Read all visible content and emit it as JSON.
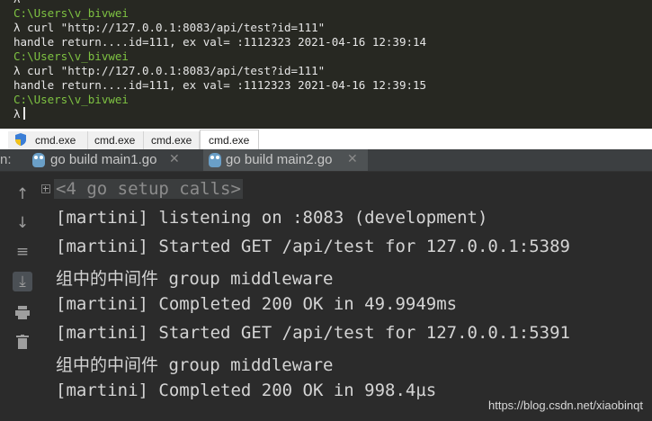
{
  "cmd_window": {
    "lines": [
      {
        "text": "λ",
        "kind": "prompt"
      },
      {
        "text": "C:\\Users\\v_bivwei",
        "kind": "path"
      },
      {
        "text": "λ curl \"http://127.0.0.1:8083/api/test?id=111\"",
        "kind": "text"
      },
      {
        "text": "handle return....id=111, ex val= :1112323 2021-04-16 12:39:14",
        "kind": "text"
      },
      {
        "text": "C:\\Users\\v_bivwei",
        "kind": "path"
      },
      {
        "text": "λ curl \"http://127.0.0.1:8083/api/test?id=111\"",
        "kind": "text"
      },
      {
        "text": "handle return....id=111, ex val= :1112323 2021-04-16 12:39:15",
        "kind": "text"
      },
      {
        "text": "C:\\Users\\v_bivwei",
        "kind": "path"
      },
      {
        "text": "λ",
        "kind": "prompt"
      }
    ],
    "colors": {
      "background": "#272822",
      "path": "#7ec242",
      "text": "#e6e6e6"
    }
  },
  "cmd_tabs": [
    {
      "label": "cmd.exe"
    },
    {
      "label": "cmd.exe"
    },
    {
      "label": "cmd.exe"
    },
    {
      "label": "cmd.exe",
      "active": true
    }
  ],
  "run_bar": {
    "label": "n:",
    "tabs": [
      {
        "label": "go build main1.go",
        "icon": "gopher-icon"
      },
      {
        "label": "go build main2.go",
        "icon": "gopher-icon",
        "active": true
      }
    ]
  },
  "tools": [
    {
      "name": "up-arrow-icon",
      "glyph": "↑"
    },
    {
      "name": "down-arrow-icon",
      "glyph": "↓"
    },
    {
      "name": "soft-wrap-icon",
      "glyph": "≡"
    },
    {
      "name": "scroll-to-end-icon",
      "glyph": "⤓",
      "active": true
    },
    {
      "name": "print-icon",
      "glyph": "▬"
    },
    {
      "name": "trash-icon",
      "glyph": "▮"
    }
  ],
  "console": {
    "folded": "<4 go setup calls>",
    "lines": [
      "[martini] listening on :8083 (development)",
      "[martini] Started GET /api/test for 127.0.0.1:5389",
      "组中的中间件 group middleware",
      "[martini] Completed 200 OK in 49.9949ms",
      "[martini] Started GET /api/test for 127.0.0.1:5391",
      "组中的中间件 group middleware",
      "[martini] Completed 200 OK in 998.4µs"
    ]
  },
  "watermark": "https://blog.csdn.net/xiaobinqt"
}
